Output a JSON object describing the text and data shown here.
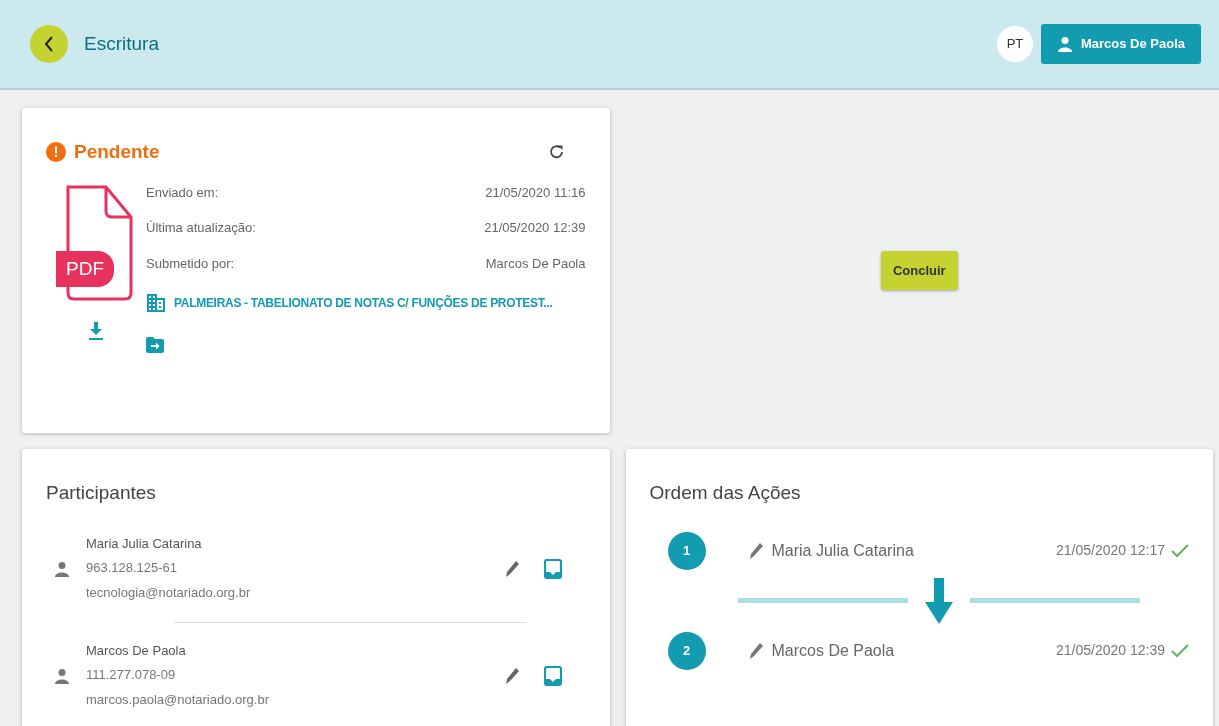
{
  "header": {
    "title": "Escritura",
    "language": "PT",
    "user": "Marcos De Paola"
  },
  "document": {
    "status": "Pendente",
    "fields": [
      {
        "label": "Enviado em:",
        "value": "21/05/2020 11:16"
      },
      {
        "label": "Última atualização:",
        "value": "21/05/2020 12:39"
      },
      {
        "label": "Submetido por:",
        "value": "Marcos De Paola"
      }
    ],
    "file_badge": "PDF",
    "office": "PALMEIRAS - TABELIONATO DE NOTAS C/ FUNÇÕES DE PROTEST..."
  },
  "conclude_button": "Concluir",
  "participants": {
    "title": "Participantes",
    "items": [
      {
        "name": "Maria Julia Catarina",
        "document": "963.128.125-61",
        "email": "tecnologia@notariado.org.br"
      },
      {
        "name": "Marcos De Paola",
        "document": "111.277.078-09",
        "email": "marcos.paola@notariado.org.br"
      }
    ]
  },
  "actions": {
    "title": "Ordem das Ações",
    "items": [
      {
        "number": "1",
        "name": "Maria Julia Catarina",
        "time": "21/05/2020 12:17",
        "done": true
      },
      {
        "number": "2",
        "name": "Marcos De Paola",
        "time": "21/05/2020 12:39",
        "done": true
      }
    ]
  }
}
